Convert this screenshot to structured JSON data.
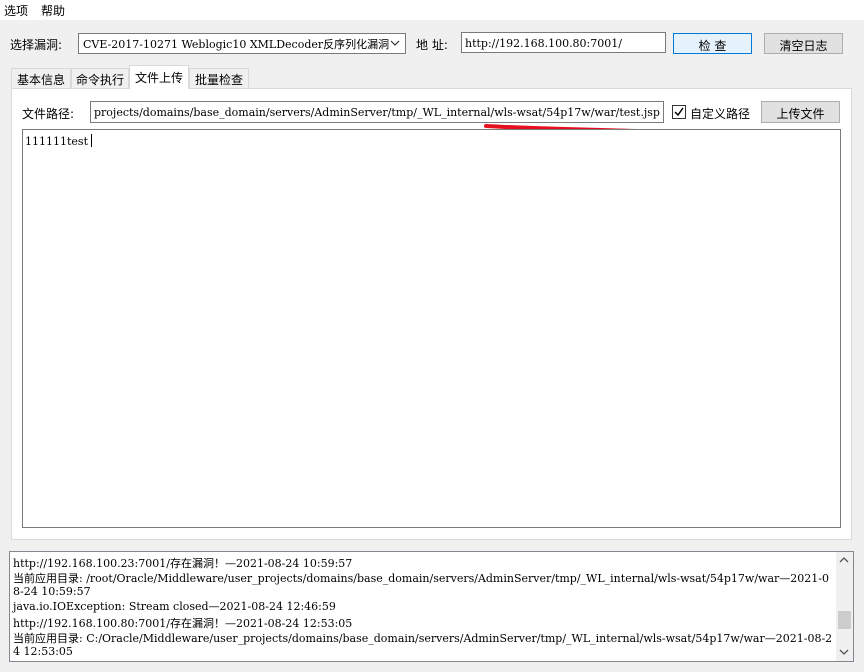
{
  "menu": {
    "options": "选项",
    "help": "帮助"
  },
  "toolbar": {
    "vuln_label": "选择漏洞:",
    "vuln_selected": "CVE-2017-10271 Weblogic10 XMLDecoder反序列化漏洞",
    "address_label": "地 址:",
    "address_value": "http://192.168.100.80:7001/",
    "check_button": "检 查",
    "clear_log_button": "清空日志"
  },
  "tabs": [
    {
      "label": "基本信息"
    },
    {
      "label": "命令执行"
    },
    {
      "label": "文件上传",
      "active": true
    },
    {
      "label": "批量检查"
    }
  ],
  "upload": {
    "path_label": "文件路径:",
    "path_value": "projects/domains/base_domain/servers/AdminServer/tmp/_WL_internal/wls-wsat/54p17w/war/test.jsp",
    "custom_path_label": "自定义路径",
    "custom_path_checked": true,
    "upload_button": "上传文件",
    "content": "111111test"
  },
  "log": [
    "http://192.168.100.23:7001/存在漏洞！—2021-08-24 10:59:57",
    "当前应用目录: /root/Oracle/Middleware/user_projects/domains/base_domain/servers/AdminServer/tmp/_WL_internal/wls-wsat/54p17w/war—2021-0",
    "8-24 10:59:57",
    "java.io.IOException: Stream closed—2021-08-24 12:46:59",
    "http://192.168.100.80:7001/存在漏洞！—2021-08-24 12:53:05",
    "当前应用目录: C:/Oracle/Middleware/user_projects/domains/base_domain/servers/AdminServer/tmp/_WL_internal/wls-wsat/54p17w/war—2021-08-2",
    "4 12:53:05"
  ],
  "colors": {
    "annotation": "#e8101e",
    "focus": "#0078d7"
  }
}
